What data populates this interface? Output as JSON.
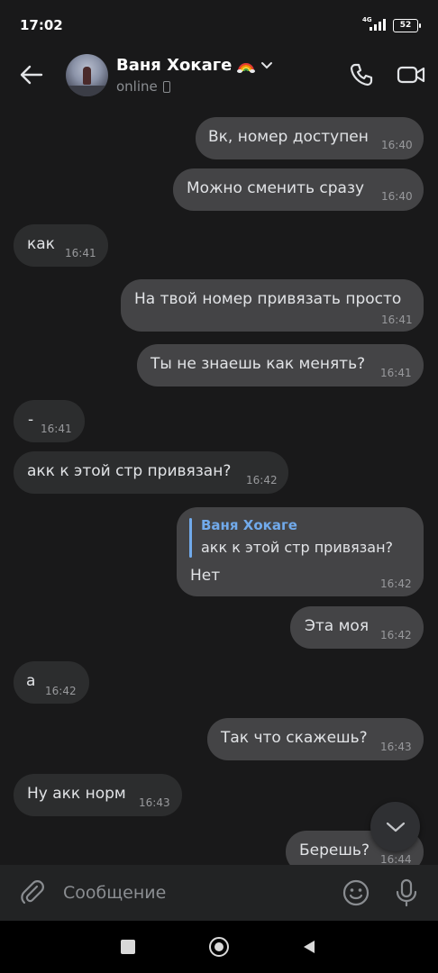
{
  "status_bar": {
    "time": "17:02",
    "network": "4G",
    "battery": "52"
  },
  "header": {
    "contact_name": "Ваня Хокаге",
    "name_emoji": "rainbow-icon",
    "status": "online",
    "status_device": "phone-icon"
  },
  "messages": [
    {
      "direction": "out",
      "text": "Вк, номер доступен",
      "time": "16:40"
    },
    {
      "direction": "out",
      "text": "Можно сменить сразу",
      "time": "16:40"
    },
    {
      "direction": "in",
      "text": "как",
      "time": "16:41"
    },
    {
      "direction": "out",
      "text": "На твой номер привязать просто",
      "time": "16:41"
    },
    {
      "direction": "out",
      "text": "Ты не знаешь как менять?",
      "time": "16:41"
    },
    {
      "direction": "in",
      "text": "-",
      "time": "16:41"
    },
    {
      "direction": "in",
      "text": "акк к этой стр привязан?",
      "time": "16:42"
    },
    {
      "direction": "out",
      "reply_to": {
        "author": "Ваня Хокаге",
        "text": "акк к этой стр привязан?"
      },
      "text": "Нет",
      "time": "16:42"
    },
    {
      "direction": "out",
      "text": "Эта моя",
      "time": "16:42"
    },
    {
      "direction": "in",
      "text": "а",
      "time": "16:42"
    },
    {
      "direction": "out",
      "text": "Так что скажешь?",
      "time": "16:43"
    },
    {
      "direction": "in",
      "text": "Ну акк норм",
      "time": "16:43"
    },
    {
      "direction": "out",
      "text": "Берешь?",
      "time": "16:44"
    }
  ],
  "composer": {
    "placeholder": "Сообщение"
  },
  "colors": {
    "background": "#19191a",
    "outgoing_bubble": "#444446",
    "incoming_bubble": "#2c2d2e",
    "accent": "#71aaeb"
  }
}
